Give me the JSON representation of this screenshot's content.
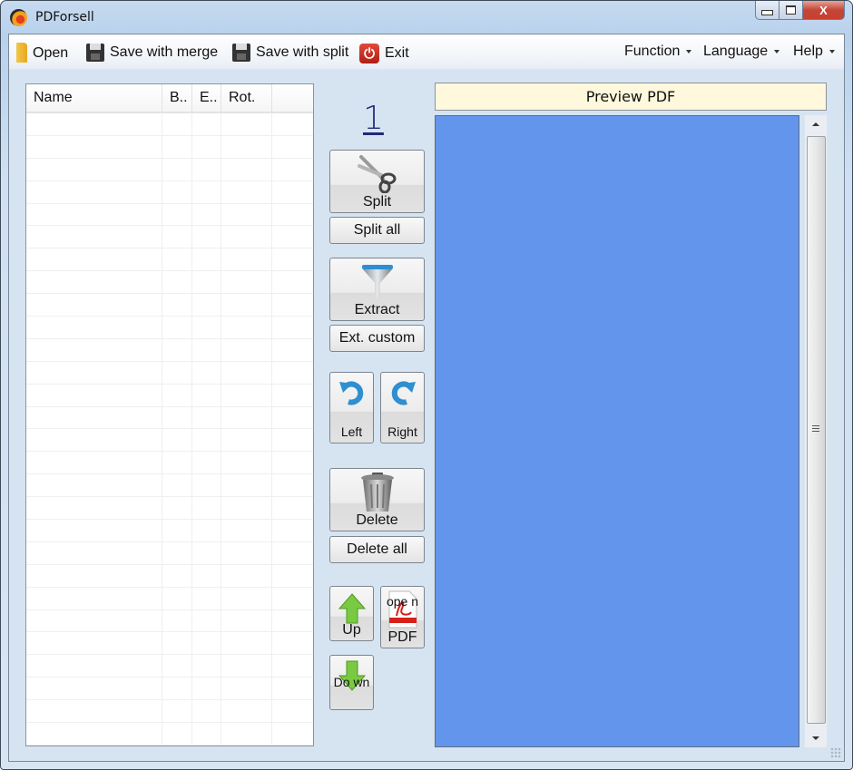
{
  "window": {
    "title": "PDForsell",
    "controls": {
      "minimize": "minimize",
      "maximize": "maximize",
      "close": "X"
    }
  },
  "menubar": {
    "left": [
      {
        "label": "Open",
        "icon": "folder-icon"
      },
      {
        "label": "Save with merge",
        "icon": "floppy-disk-icon"
      },
      {
        "label": "Save with split",
        "icon": "floppy-disks-icon"
      },
      {
        "label": "Exit",
        "icon": "power-icon"
      }
    ],
    "right": [
      {
        "label": "Function",
        "icon": "caret-down-icon"
      },
      {
        "label": "Language",
        "icon": "caret-down-icon"
      },
      {
        "label": "Help",
        "icon": "caret-down-icon"
      }
    ]
  },
  "file_table": {
    "columns": [
      "Name",
      "B..",
      "E..",
      "Rot.",
      ""
    ],
    "rows": []
  },
  "page_counter": "1",
  "actions": {
    "split": "Split",
    "split_all": "Split all",
    "extract": "Extract",
    "ext_custom": "Ext. custom",
    "rotate_left": "Left",
    "rotate_right": "Right",
    "delete": "Delete",
    "delete_all": "Delete all",
    "up": "Up",
    "open_pdf_icon_text": "ope n",
    "open_pdf": "PDF",
    "down": "Do wn"
  },
  "preview": {
    "header": "Preview PDF",
    "background_color": "#6495ec"
  }
}
